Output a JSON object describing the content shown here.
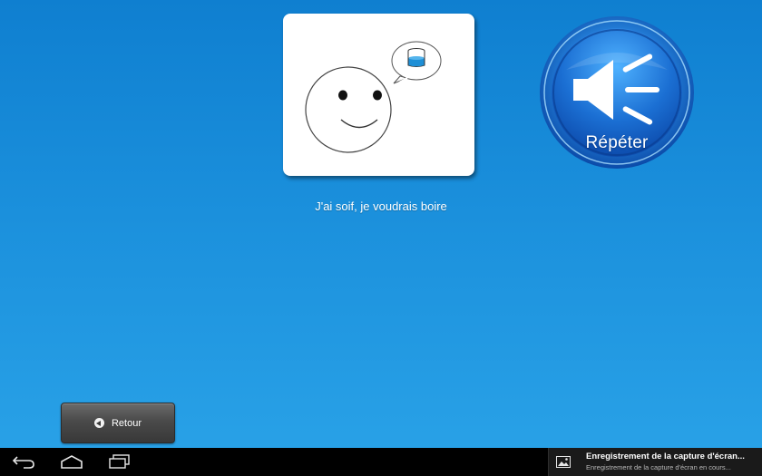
{
  "card": {
    "icon": "thirsty-face-pictogram",
    "bubble_icon": "glass-of-water-icon"
  },
  "phrase": "J'ai soif, je voudrais boire",
  "repeat_button": {
    "label": "Répéter",
    "icon": "speaker-icon",
    "color": "#1565c8"
  },
  "back_button": {
    "label": "Retour",
    "icon": "back-arrow-icon"
  },
  "system_bar": {
    "buttons": [
      "back-icon",
      "home-icon",
      "recent-apps-icon"
    ],
    "notification": {
      "icon": "image-icon",
      "title": "Enregistrement de la capture d'écran...",
      "subtitle": "Enregistrement de la capture d'écran en cours..."
    }
  },
  "colors": {
    "background_top": "#0f7fd0",
    "background_bottom": "#2aa3e8",
    "bubble_water": "#1e8fd6"
  }
}
